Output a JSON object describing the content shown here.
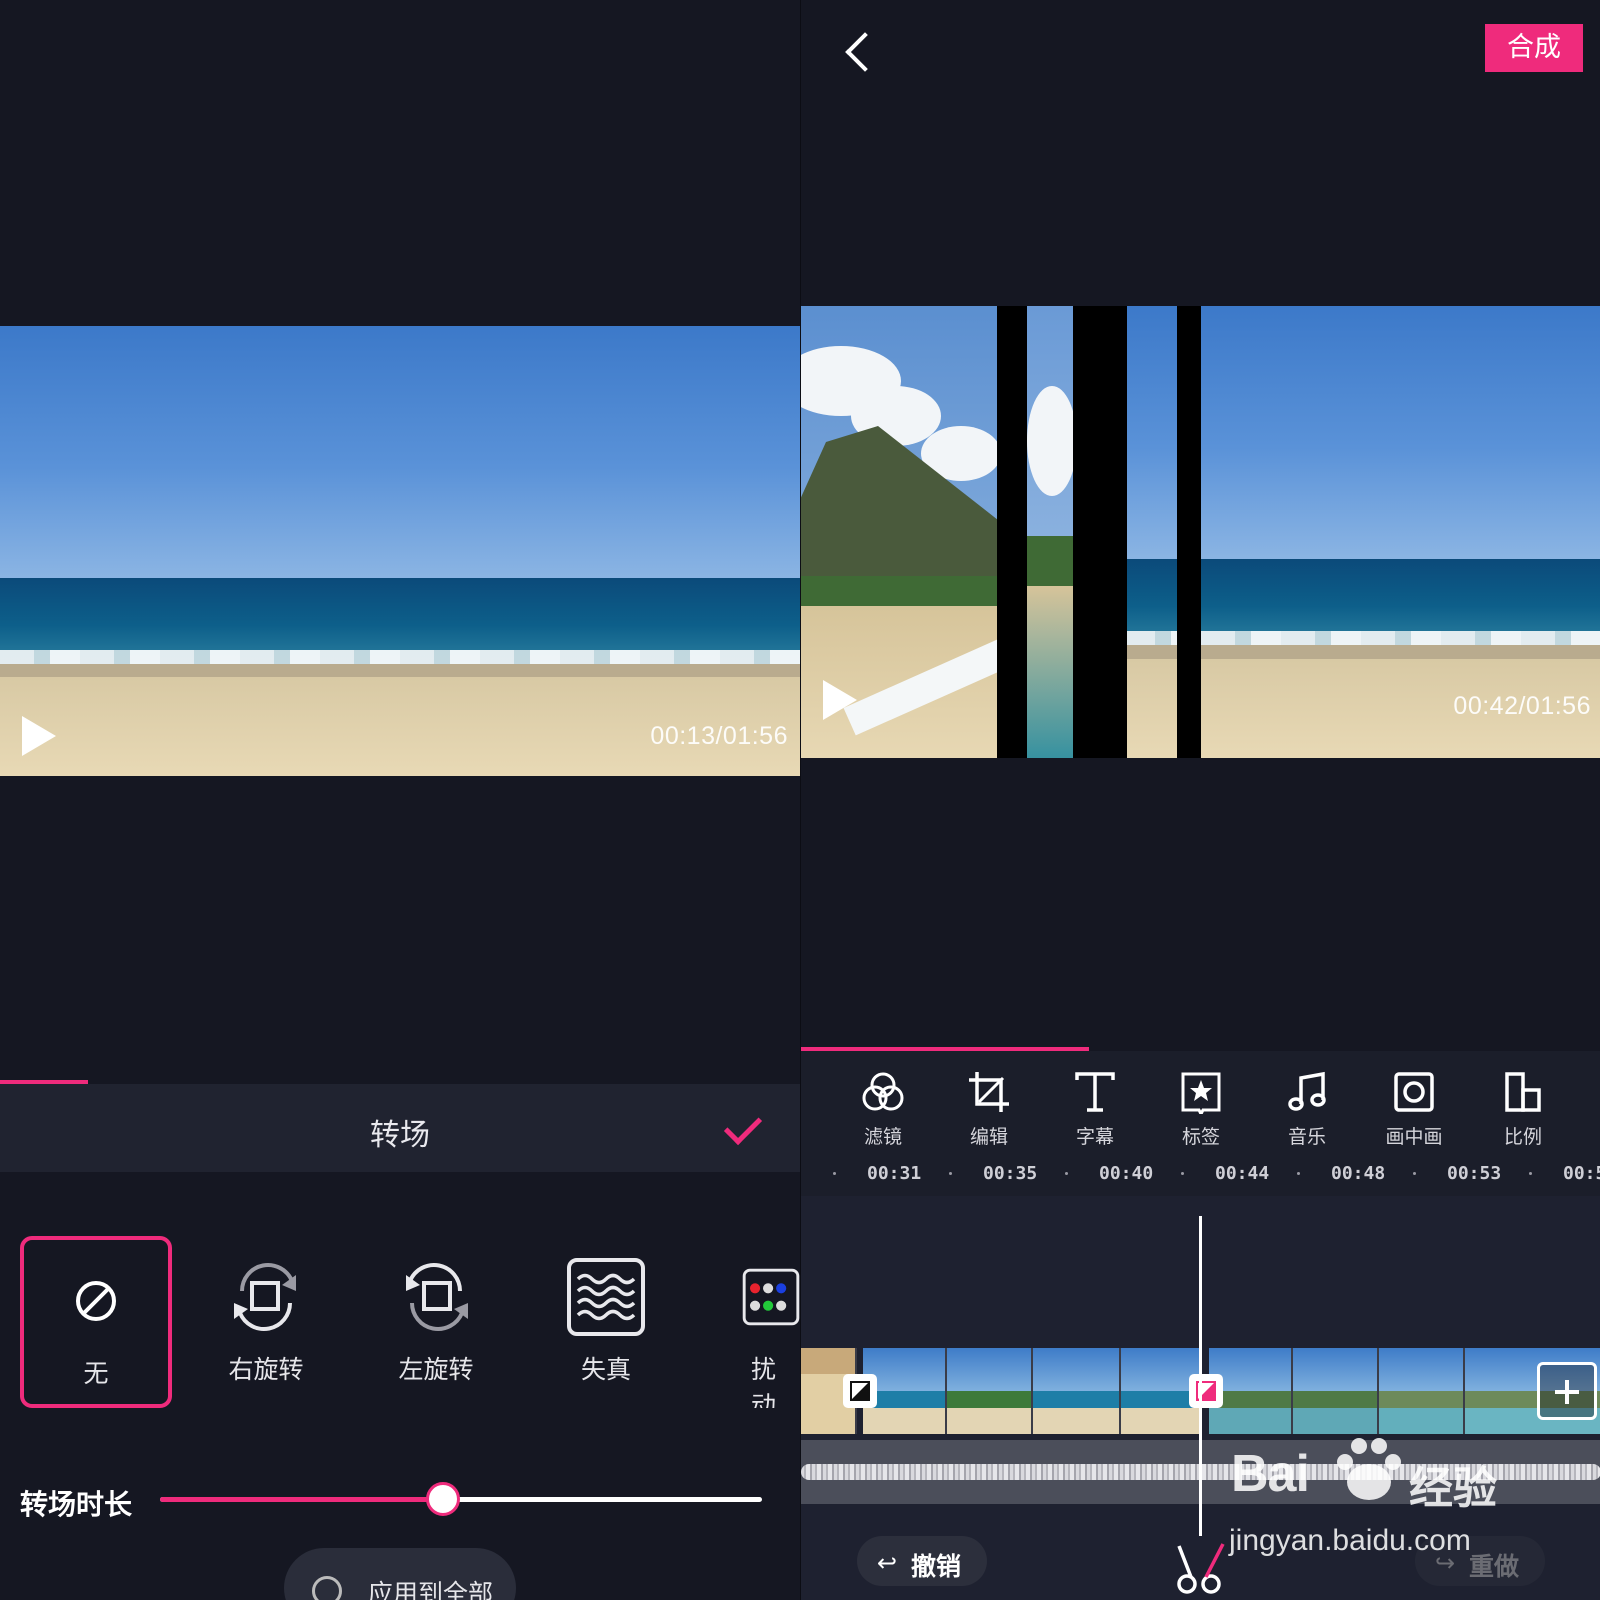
{
  "left_panel": {
    "preview": {
      "current_time": "00:13",
      "total_time": "01:56",
      "time_display": "00:13/01:56"
    },
    "sheet": {
      "title": "转场",
      "confirm_icon": "check-icon"
    },
    "transitions": [
      {
        "label": "无",
        "icon": "no-transition-icon",
        "selected": true
      },
      {
        "label": "右旋转",
        "icon": "rotate-right-icon",
        "selected": false
      },
      {
        "label": "左旋转",
        "icon": "rotate-left-icon",
        "selected": false
      },
      {
        "label": "失真",
        "icon": "distortion-icon",
        "selected": false
      },
      {
        "label": "扰动",
        "icon": "disturbance-icon",
        "selected": false
      }
    ],
    "duration": {
      "label": "转场时长",
      "value_fraction": 0.47
    },
    "apply_all": {
      "label": "应用到全部",
      "checked": false
    },
    "progress_fraction": 0.11
  },
  "right_panel": {
    "header": {
      "back_icon": "chevron-left-icon",
      "compose_label": "合成"
    },
    "preview": {
      "time_display": "00:42/01:56"
    },
    "progress_fraction": 0.36,
    "tools": [
      {
        "label": "滤镜",
        "icon": "filter-icon"
      },
      {
        "label": "编辑",
        "icon": "crop-icon"
      },
      {
        "label": "字幕",
        "icon": "text-icon"
      },
      {
        "label": "标签",
        "icon": "sticker-icon"
      },
      {
        "label": "音乐",
        "icon": "music-icon"
      },
      {
        "label": "画中画",
        "icon": "pip-icon"
      },
      {
        "label": "比例",
        "icon": "ratio-icon"
      }
    ],
    "ruler": [
      "00:31",
      "00:35",
      "00:40",
      "00:44",
      "00:48",
      "00:53",
      "00:5"
    ],
    "undo_label": "撤销",
    "redo_label": "重做"
  },
  "watermark": {
    "brand": "Bai",
    "brand_cn": "经验",
    "url": "jingyan.baidu.com"
  },
  "colors": {
    "accent": "#ef2b7c",
    "background": "#151722",
    "panel": "#202330"
  }
}
